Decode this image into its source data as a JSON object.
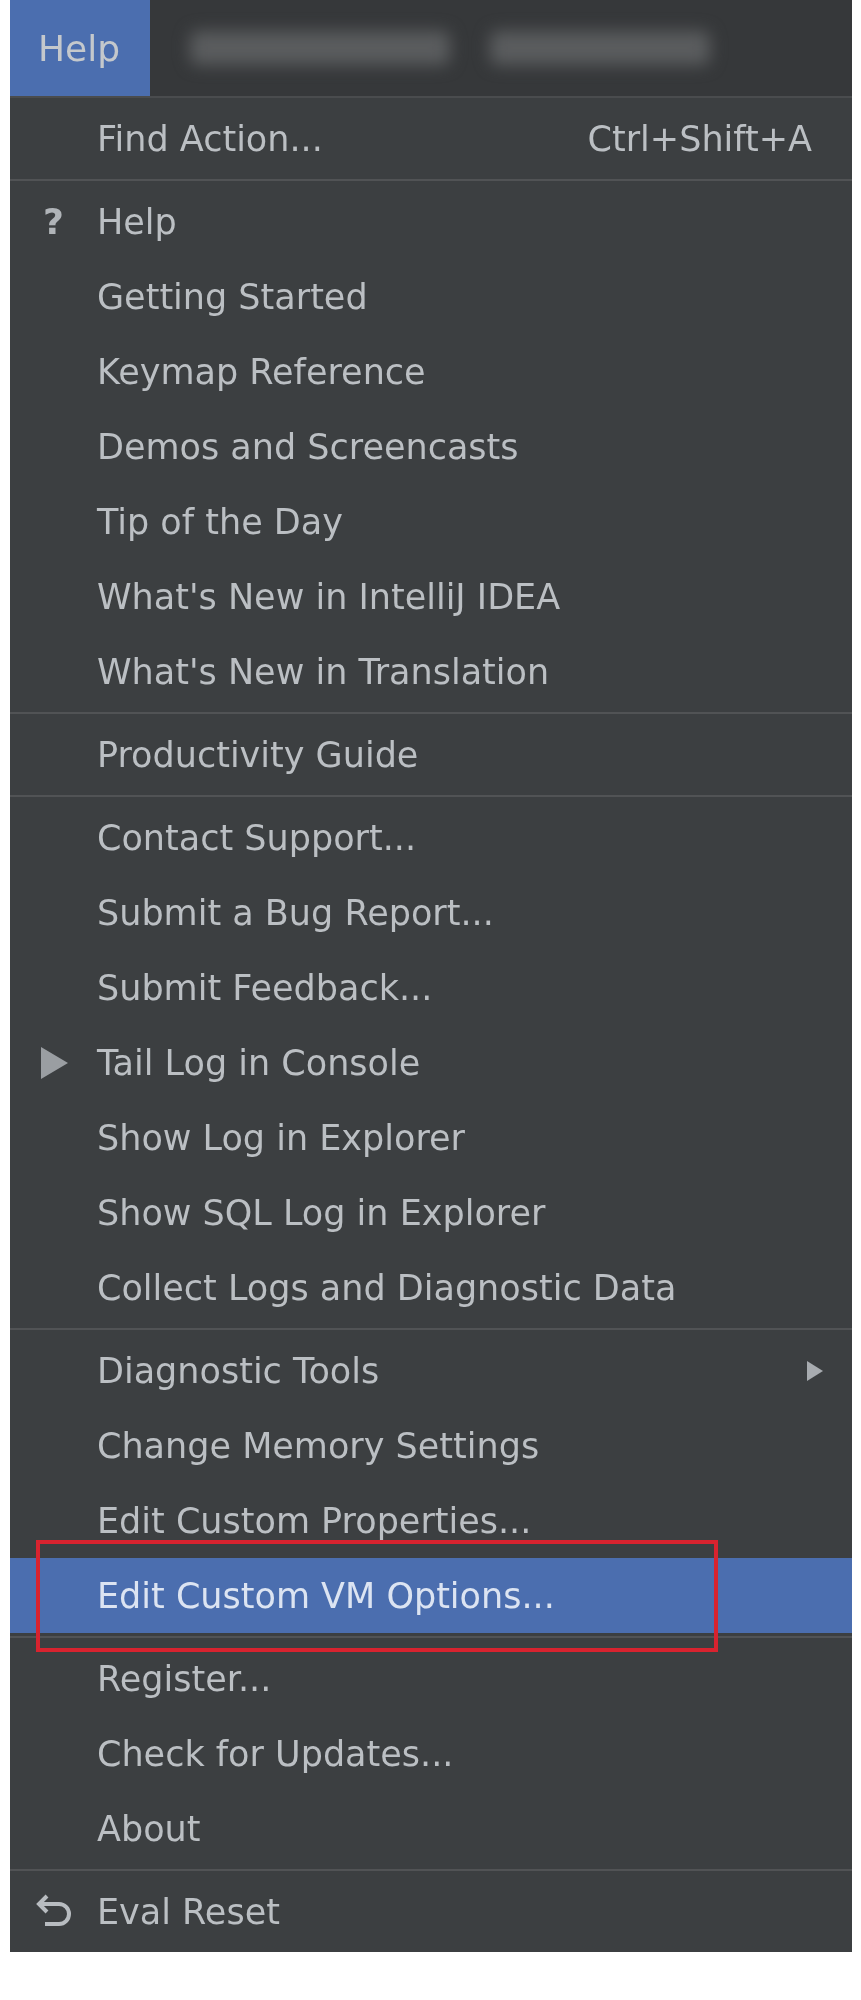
{
  "menubar": [
    {
      "label": "Help",
      "selected": true
    }
  ],
  "menu": {
    "sections": [
      [
        {
          "label": "Find Action...",
          "shortcut": "Ctrl+Shift+A",
          "kind": "plain",
          "submenu": false,
          "selected": false,
          "annotated": false
        }
      ],
      [
        {
          "label": "Help",
          "kind": "glyph",
          "glyph": "?",
          "submenu": false,
          "selected": false,
          "annotated": false
        },
        {
          "label": "Getting Started",
          "kind": "plain",
          "submenu": false,
          "selected": false,
          "annotated": false
        },
        {
          "label": "Keymap Reference",
          "kind": "plain",
          "submenu": false,
          "selected": false,
          "annotated": false
        },
        {
          "label": "Demos and Screencasts",
          "kind": "plain",
          "submenu": false,
          "selected": false,
          "annotated": false
        },
        {
          "label": "Tip of the Day",
          "kind": "plain",
          "submenu": false,
          "selected": false,
          "annotated": false
        },
        {
          "label": "What's New in IntelliJ IDEA",
          "kind": "plain",
          "submenu": false,
          "selected": false,
          "annotated": false
        },
        {
          "label": "What's New in Translation",
          "kind": "plain",
          "submenu": false,
          "selected": false,
          "annotated": false
        }
      ],
      [
        {
          "label": "Productivity Guide",
          "kind": "plain",
          "submenu": false,
          "selected": false,
          "annotated": false
        }
      ],
      [
        {
          "label": "Contact Support...",
          "kind": "plain",
          "submenu": false,
          "selected": false,
          "annotated": false
        },
        {
          "label": "Submit a Bug Report...",
          "kind": "plain",
          "submenu": false,
          "selected": false,
          "annotated": false
        },
        {
          "label": "Submit Feedback...",
          "kind": "plain",
          "submenu": false,
          "selected": false,
          "annotated": false
        },
        {
          "label": "Tail Log in Console",
          "kind": "play",
          "submenu": false,
          "selected": false,
          "annotated": false
        },
        {
          "label": "Show Log in Explorer",
          "kind": "plain",
          "submenu": false,
          "selected": false,
          "annotated": false
        },
        {
          "label": "Show SQL Log in Explorer",
          "kind": "plain",
          "submenu": false,
          "selected": false,
          "annotated": false
        },
        {
          "label": "Collect Logs and Diagnostic Data",
          "kind": "plain",
          "submenu": false,
          "selected": false,
          "annotated": false
        }
      ],
      [
        {
          "label": "Diagnostic Tools",
          "kind": "plain",
          "submenu": true,
          "selected": false,
          "annotated": false
        },
        {
          "label": "Change Memory Settings",
          "kind": "plain",
          "submenu": false,
          "selected": false,
          "annotated": false
        },
        {
          "label": "Edit Custom Properties...",
          "kind": "plain",
          "submenu": false,
          "selected": false,
          "annotated": false
        },
        {
          "label": "Edit Custom VM Options...",
          "kind": "plain",
          "submenu": false,
          "selected": true,
          "annotated": true
        }
      ],
      [
        {
          "label": "Register...",
          "kind": "plain",
          "submenu": false,
          "selected": false,
          "annotated": false
        },
        {
          "label": "Check for Updates...",
          "kind": "plain",
          "submenu": false,
          "selected": false,
          "annotated": false
        },
        {
          "label": "About",
          "kind": "plain",
          "submenu": false,
          "selected": false,
          "annotated": false
        }
      ],
      [
        {
          "label": "Eval Reset",
          "kind": "undo",
          "submenu": false,
          "selected": false,
          "annotated": false
        }
      ]
    ]
  }
}
